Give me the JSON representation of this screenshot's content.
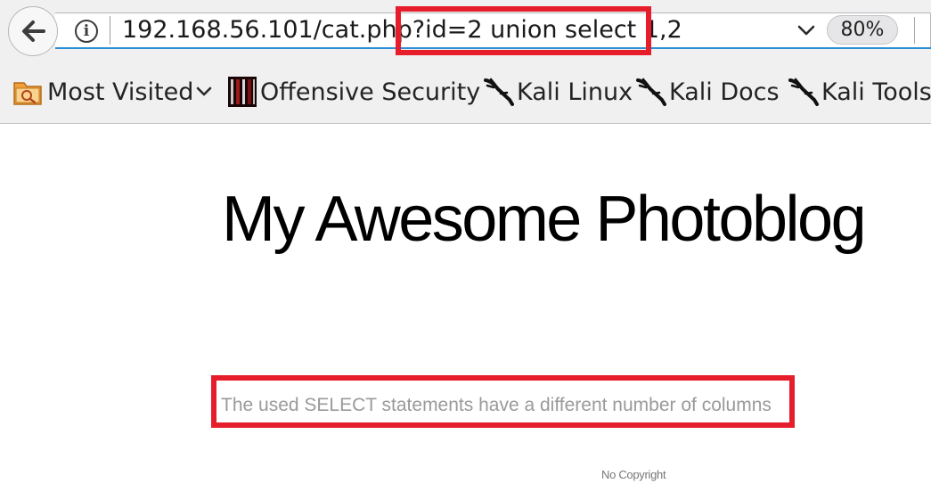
{
  "browser": {
    "url": "192.168.56.101/cat.php?id=2 union select 1,2",
    "zoom": "80%"
  },
  "bookmarks": [
    {
      "label": "Most Visited",
      "icon": "most-visited-folder-icon"
    },
    {
      "label": "Offensive Security",
      "icon": "offensive-security-icon"
    },
    {
      "label": "Kali Linux",
      "icon": "kali-dragon-icon"
    },
    {
      "label": "Kali Docs",
      "icon": "kali-dragon-icon"
    },
    {
      "label": "Kali Tools",
      "icon": "kali-dragon-icon"
    }
  ],
  "page": {
    "title": "My Awesome Photoblog",
    "error_message": "The used SELECT statements have a different number of columns",
    "footer": "No Copyright"
  },
  "colors": {
    "highlight": "#e61e2b",
    "url_focus": "#2a8fd6",
    "error_text": "#9a9a9a"
  }
}
